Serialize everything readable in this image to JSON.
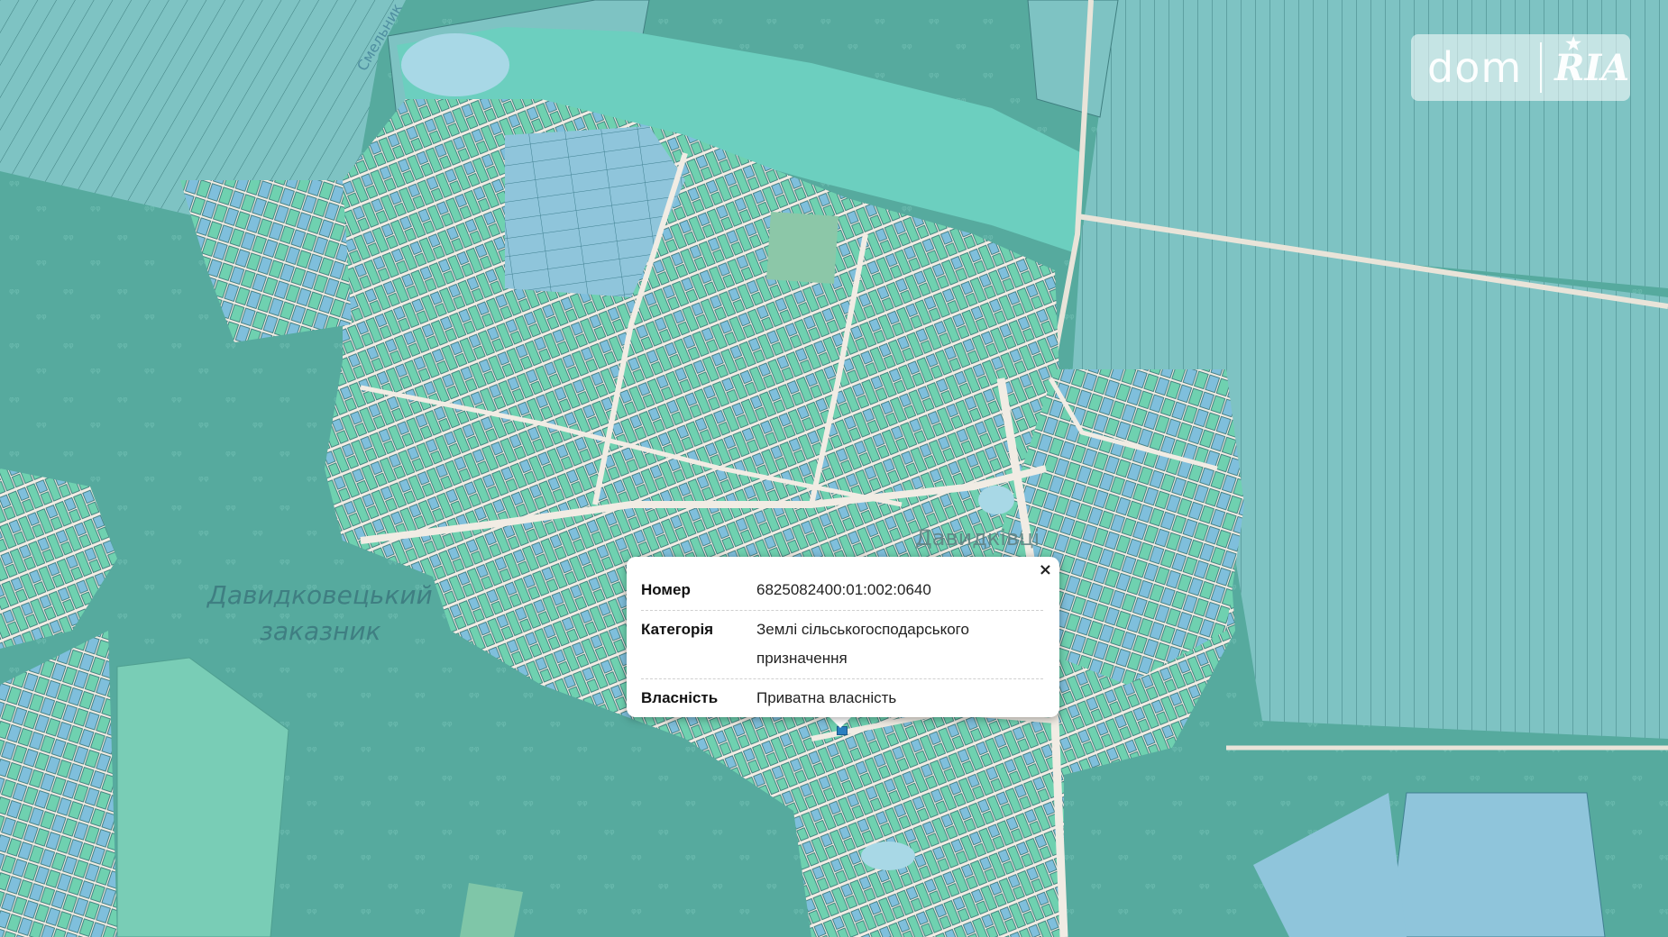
{
  "map": {
    "labels": {
      "reserve_line1": "Давидковецький",
      "reserve_line2": "заказник",
      "village": "Давидківці",
      "river": "Смельник"
    }
  },
  "logo": {
    "left_text": "dom",
    "right_text": "RIA"
  },
  "popup": {
    "close_label": "×",
    "rows": [
      {
        "key": "Номер",
        "value": "6825082400:01:002:0640"
      },
      {
        "key": "Категорія",
        "value": "Землі сільськогосподарського призначення"
      },
      {
        "key": "Власність",
        "value": "Приватна власність"
      }
    ]
  },
  "colors": {
    "forest": "#56aa9e",
    "agri_parcel": "#7cc0c4",
    "blue_parcel": "#8fc5db",
    "green_parcel": "#6fd1b0",
    "road": "#f1ece4",
    "water": "#6ccfbf",
    "lake": "#a8d8e6"
  }
}
